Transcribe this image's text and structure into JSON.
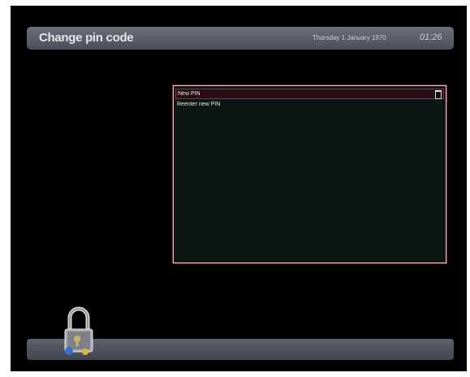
{
  "header": {
    "title": "Change pin code",
    "date": "Thursday 1 January 1970",
    "time": "01:26"
  },
  "pin_dialog": {
    "fields": [
      {
        "label": "New PIN"
      },
      {
        "label": "Reenter new PIN"
      }
    ]
  },
  "icons": {
    "lock": "padlock-icon"
  },
  "colors": {
    "header_bar": "#5a5f68",
    "dialog_border": "#cfcfcf",
    "selected_row": "#2a0c12",
    "background": "#000000"
  }
}
